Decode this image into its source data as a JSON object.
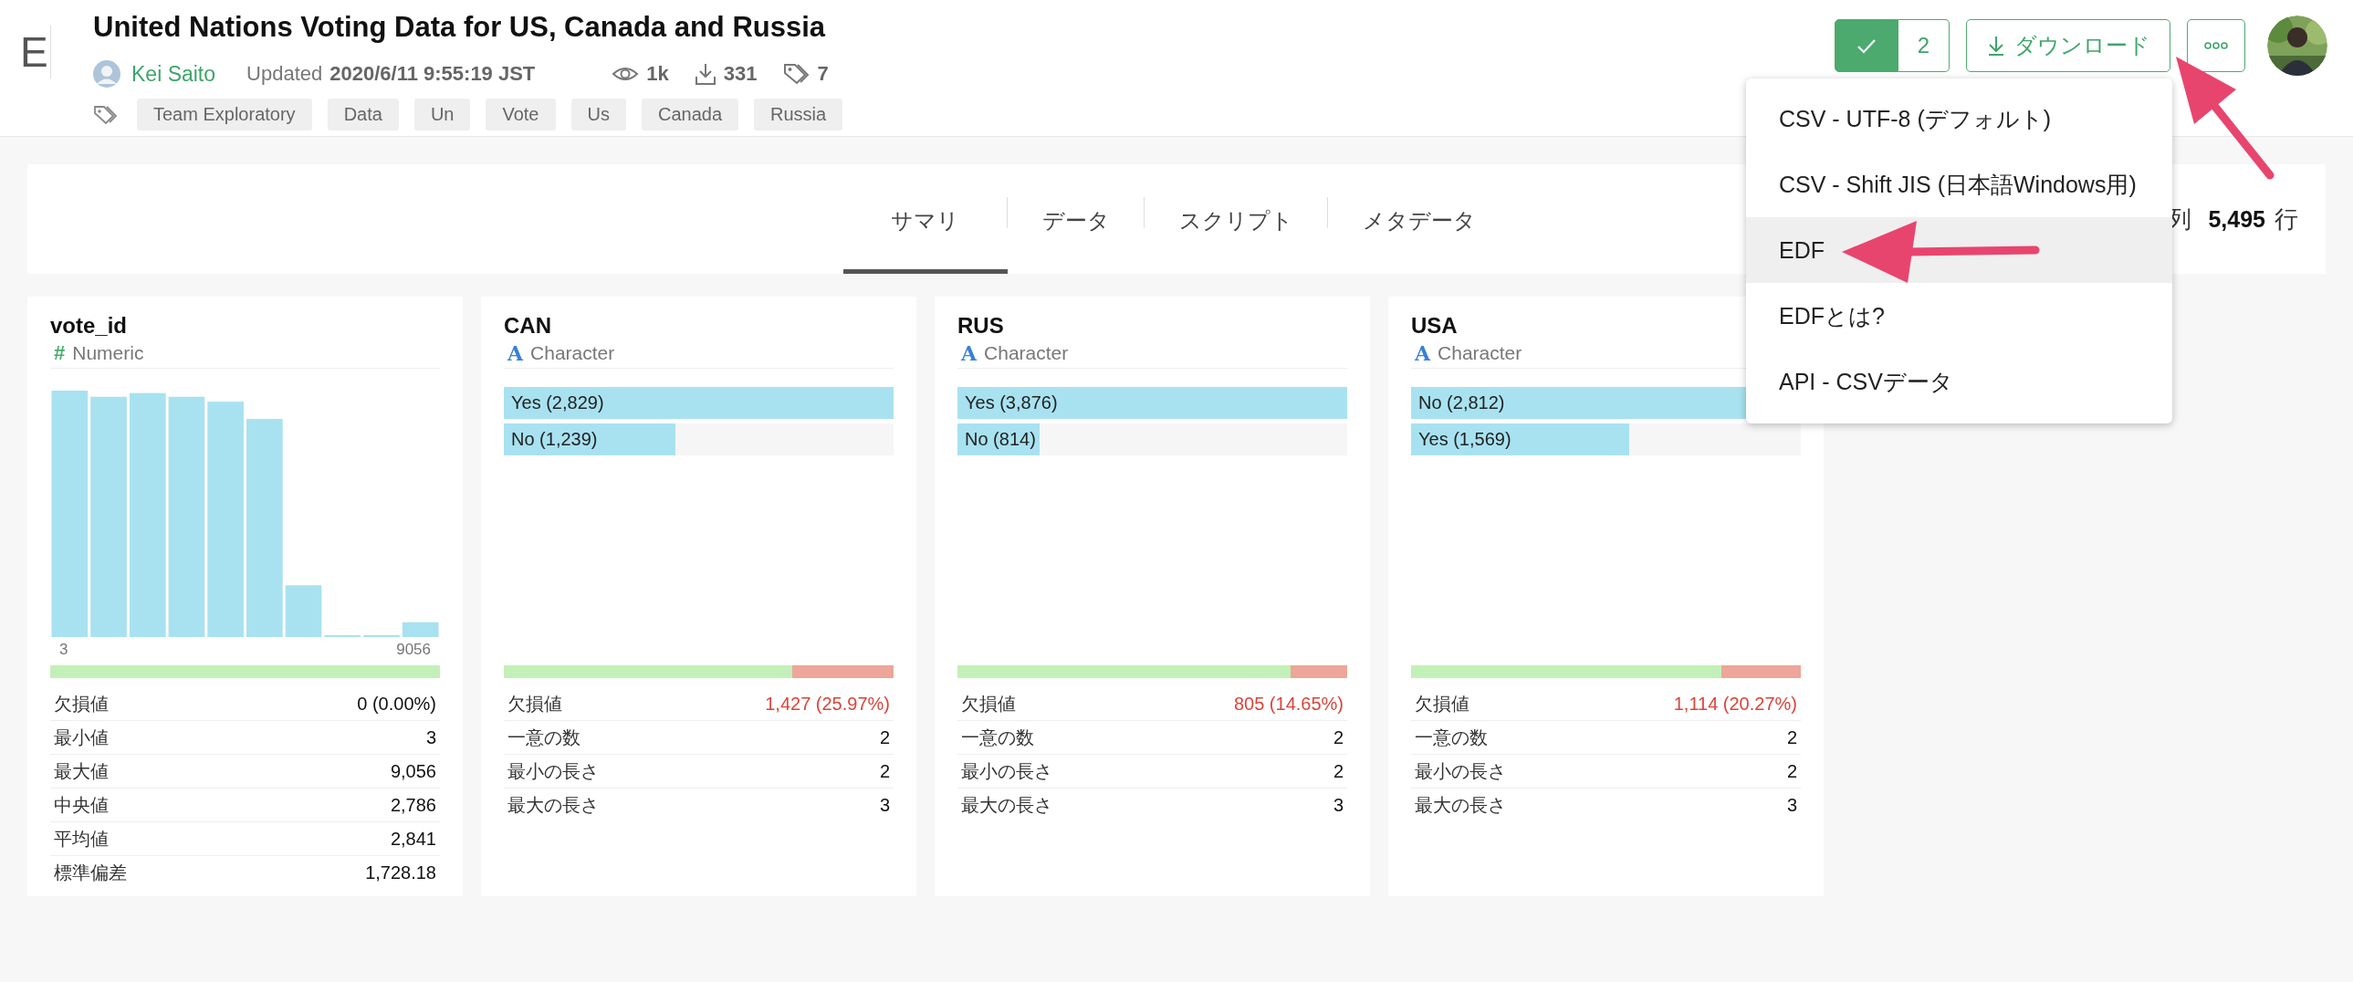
{
  "header": {
    "logo": "E",
    "title": "United Nations Voting Data for US, Canada and Russia",
    "author": "Kei Saito",
    "updated_label": "Updated",
    "updated_at": "2020/6/11 9:55:19 JST",
    "views": "1k",
    "downloads": "331",
    "tag_count": "7",
    "tags": [
      "Team Exploratory",
      "Data",
      "Un",
      "Vote",
      "Us",
      "Canada",
      "Russia"
    ]
  },
  "toolbar": {
    "like_count": "2",
    "download_label": "ダウンロード"
  },
  "download_menu": {
    "items": [
      {
        "label": "CSV - UTF-8 (デフォルト)",
        "selected": false
      },
      {
        "label": "CSV - Shift JIS (日本語Windows用)",
        "selected": false
      },
      {
        "label": "EDF",
        "selected": true
      },
      {
        "label": "EDFとは?",
        "selected": false
      },
      {
        "label": "API - CSVデータ",
        "selected": false
      }
    ]
  },
  "tabs": [
    {
      "label": "サマリ",
      "selected": true
    },
    {
      "label": "データ",
      "selected": false
    },
    {
      "label": "スクリプト",
      "selected": false
    },
    {
      "label": "メタデータ",
      "selected": false
    }
  ],
  "summary": {
    "columns_label": "列",
    "rows_value": "5,495",
    "rows_label": "行"
  },
  "columns": [
    {
      "name": "vote_id",
      "kind": "numeric",
      "type_mark": "#",
      "type": "Numeric",
      "axis_min": "3",
      "axis_max": "9056",
      "completeness": {
        "level": 1
      },
      "stats": [
        {
          "label": "欠損値",
          "value": "0 (0.00%)",
          "alert": false
        },
        {
          "label": "最小値",
          "value": "3",
          "alert": false
        },
        {
          "label": "最大値",
          "value": "9,056",
          "alert": false
        },
        {
          "label": "中央値",
          "value": "2,786",
          "alert": false
        },
        {
          "label": "平均値",
          "value": "2,841",
          "alert": false
        },
        {
          "label": "標準偏差",
          "value": "1,728.18",
          "alert": false
        }
      ]
    },
    {
      "name": "CAN",
      "kind": "character",
      "type_mark": "A",
      "type": "Character",
      "categories": [
        {
          "label": "Yes (2,829)",
          "level": 1
        },
        {
          "label": "No (1,239)",
          "level": 0.44
        }
      ],
      "completeness": {
        "level": 0.74
      },
      "stats": [
        {
          "label": "欠損値",
          "value": "1,427 (25.97%)",
          "alert": true
        },
        {
          "label": "一意の数",
          "value": "2",
          "alert": false
        },
        {
          "label": "最小の長さ",
          "value": "2",
          "alert": false
        },
        {
          "label": "最大の長さ",
          "value": "3",
          "alert": false
        }
      ]
    },
    {
      "name": "RUS",
      "kind": "character",
      "type_mark": "A",
      "type": "Character",
      "categories": [
        {
          "label": "Yes (3,876)",
          "level": 1
        },
        {
          "label": "No (814)",
          "level": 0.21
        }
      ],
      "completeness": {
        "level": 0.854
      },
      "stats": [
        {
          "label": "欠損値",
          "value": "805 (14.65%)",
          "alert": true
        },
        {
          "label": "一意の数",
          "value": "2",
          "alert": false
        },
        {
          "label": "最小の長さ",
          "value": "2",
          "alert": false
        },
        {
          "label": "最大の長さ",
          "value": "3",
          "alert": false
        }
      ]
    },
    {
      "name": "USA",
      "kind": "character",
      "type_mark": "A",
      "type": "Character",
      "categories": [
        {
          "label": "No (2,812)",
          "level": 1
        },
        {
          "label": "Yes (1,569)",
          "level": 0.56
        }
      ],
      "completeness": {
        "level": 0.797
      },
      "stats": [
        {
          "label": "欠損値",
          "value": "1,114 (20.27%)",
          "alert": true
        },
        {
          "label": "一意の数",
          "value": "2",
          "alert": false
        },
        {
          "label": "最小の長さ",
          "value": "2",
          "alert": false
        },
        {
          "label": "最大の長さ",
          "value": "3",
          "alert": false
        }
      ]
    }
  ]
}
